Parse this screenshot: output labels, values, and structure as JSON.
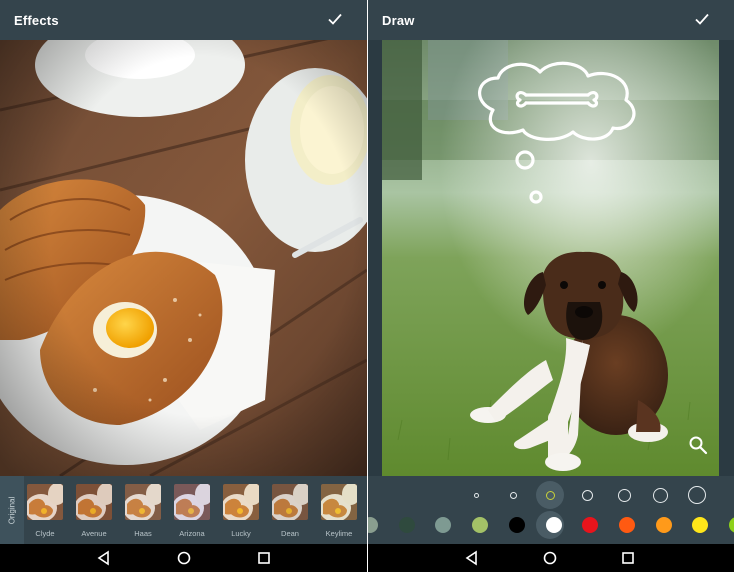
{
  "left_screen": {
    "title": "Effects",
    "confirm_icon": "check-icon",
    "original_label": "Original",
    "filters": [
      {
        "label": "Clyde",
        "tint": "#c98a5a"
      },
      {
        "label": "Avenue",
        "tint": "#b06a45"
      },
      {
        "label": "Haas",
        "tint": "#c59a7a"
      },
      {
        "label": "Arizona",
        "tint": "#a58bbf"
      },
      {
        "label": "Lucky",
        "tint": "#d6a25e"
      },
      {
        "label": "Dean",
        "tint": "#9e7d66"
      },
      {
        "label": "Keylime",
        "tint": "#c7b56a"
      }
    ],
    "photo_subject": "pastry-on-plate-photo"
  },
  "right_screen": {
    "title": "Draw",
    "confirm_icon": "check-icon",
    "photo_subject": "puppy-on-grass-photo",
    "zoom_icon": "magnifier-icon",
    "brush_sizes_selected_index": 2,
    "brush_size_count": 7,
    "colors": [
      "#8a9e8f",
      "#2f4a3e",
      "#7e9a92",
      "#a3c167",
      "#000000",
      "#ffffff",
      "#e8141c",
      "#ff5a12",
      "#ff9a1a",
      "#ffe61a",
      "#8ed11a"
    ],
    "selected_color": "#ffffff"
  },
  "navbar": {
    "back_icon": "back-triangle-icon",
    "home_icon": "home-circle-icon",
    "recents_icon": "recents-square-icon"
  },
  "colors": {
    "toolbar": "#34444c",
    "accent_selected": "#c8d23a"
  }
}
